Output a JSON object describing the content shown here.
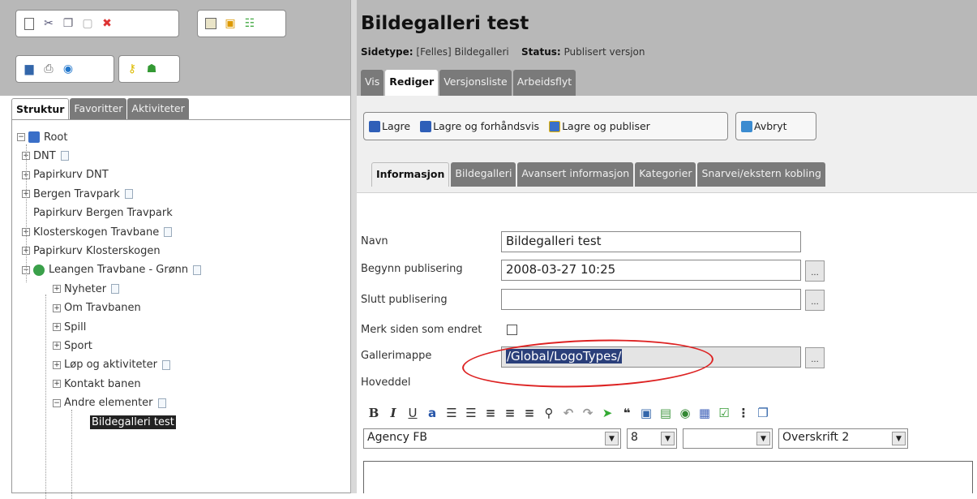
{
  "left": {
    "tabs": [
      "Struktur",
      "Favoritter",
      "Aktiviteter"
    ],
    "tree": [
      {
        "label": "Root",
        "exp": "−",
        "depth": 0,
        "doc": false,
        "icon": "database"
      },
      {
        "label": "DNT",
        "exp": "+",
        "depth": 1,
        "doc": true
      },
      {
        "label": "Papirkurv DNT",
        "exp": "+",
        "depth": 1,
        "doc": false
      },
      {
        "label": "Bergen Travpark",
        "exp": "+",
        "depth": 1,
        "doc": true
      },
      {
        "label": "Papirkurv Bergen Travpark",
        "exp": "",
        "depth": 1,
        "doc": false
      },
      {
        "label": "Klosterskogen Travbane",
        "exp": "+",
        "depth": 1,
        "doc": true
      },
      {
        "label": "Papirkurv Klosterskogen",
        "exp": "+",
        "depth": 1,
        "doc": false
      },
      {
        "label": "Leangen Travbane - Grønn",
        "exp": "−",
        "depth": 1,
        "doc": true,
        "icon": "globe"
      },
      {
        "label": "Nyheter",
        "exp": "+",
        "depth": 2,
        "doc": true
      },
      {
        "label": "Om Travbanen",
        "exp": "+",
        "depth": 2,
        "doc": false
      },
      {
        "label": "Spill",
        "exp": "+",
        "depth": 2,
        "doc": false
      },
      {
        "label": "Sport",
        "exp": "+",
        "depth": 2,
        "doc": false
      },
      {
        "label": "Løp og aktiviteter",
        "exp": "+",
        "depth": 2,
        "doc": true
      },
      {
        "label": "Kontakt banen",
        "exp": "+",
        "depth": 2,
        "doc": false
      },
      {
        "label": "Andre elementer",
        "exp": "−",
        "depth": 2,
        "doc": true
      },
      {
        "label": "Bildegalleri test",
        "exp": "",
        "depth": 3,
        "doc": false,
        "selected": true
      }
    ]
  },
  "page": {
    "title": "Bildegalleri test",
    "sidetype_label": "Sidetype:",
    "sidetype_value": "[Felles] Bildegalleri",
    "status_label": "Status:",
    "status_value": "Publisert versjon",
    "tabs": [
      "Vis",
      "Rediger",
      "Versjonsliste",
      "Arbeidsflyt"
    ]
  },
  "actions": {
    "save": "Lagre",
    "save_preview": "Lagre og forhåndsvis",
    "save_publish": "Lagre og publiser",
    "cancel": "Avbryt"
  },
  "form_tabs": [
    "Informasjon",
    "Bildegalleri",
    "Avansert informasjon",
    "Kategorier",
    "Snarvei/ekstern kobling"
  ],
  "form": {
    "navn_label": "Navn",
    "navn_value": "Bildegalleri test",
    "start_label": "Begynn publisering",
    "start_value": "2008-03-27 10:25",
    "stop_label": "Slutt publisering",
    "stop_value": "",
    "changed_label": "Merk siden som endret",
    "gallery_label": "Gallerimappe",
    "gallery_value": "/Global/LogoTypes/",
    "main_label": "Hoveddel"
  },
  "editor": {
    "font": "Agency FB",
    "size": "8",
    "blank": "",
    "style": "Overskrift 2",
    "dots": "..."
  },
  "colors": {
    "header_gray": "#b8b8b8",
    "tab_dark": "#7a7a7a",
    "highlight_oval": "#dd2222",
    "selection": "#2a3f7a"
  }
}
